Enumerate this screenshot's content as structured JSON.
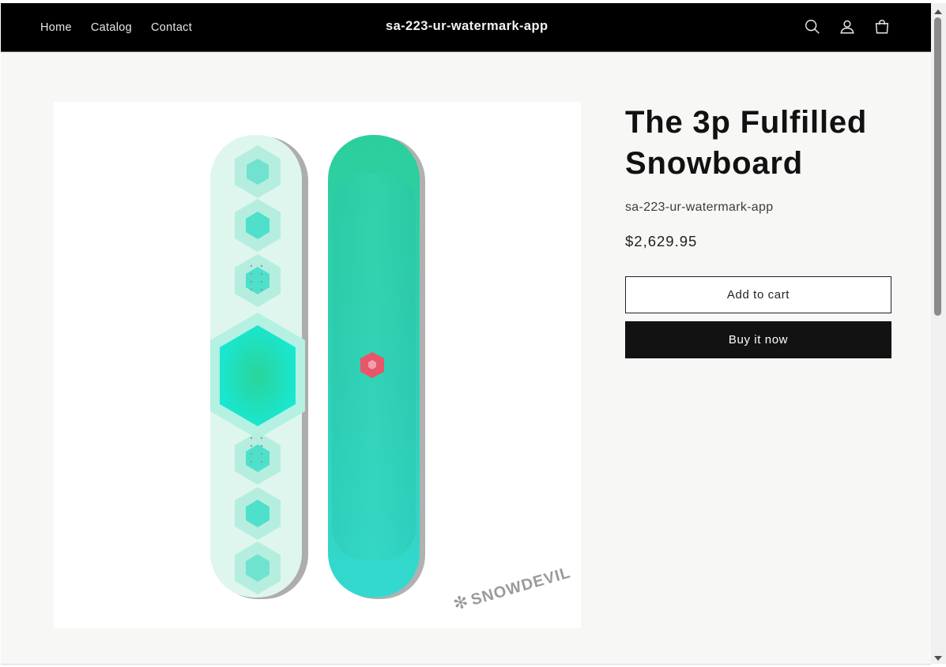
{
  "header": {
    "nav": [
      {
        "label": "Home"
      },
      {
        "label": "Catalog"
      },
      {
        "label": "Contact"
      }
    ],
    "brand": "sa-223-ur-watermark-app",
    "icons": [
      "search-icon",
      "account-icon",
      "cart-icon"
    ]
  },
  "product": {
    "title": "The 3p Fulfilled Snowboard",
    "vendor": "sa-223-ur-watermark-app",
    "price": "$2,629.95",
    "add_to_cart_label": "Add to cart",
    "buy_now_label": "Buy it now",
    "image": {
      "brand_mark": "SNOWDEVIL",
      "colors": {
        "board_light": "#dff6ee",
        "hexagon": "#6ee6cf",
        "board_teal": "#33d3b8",
        "badge": "#e8566a"
      }
    }
  },
  "colors": {
    "header_bg": "#000000",
    "page_bg": "#f7f7f5",
    "button_primary": "#121212"
  }
}
